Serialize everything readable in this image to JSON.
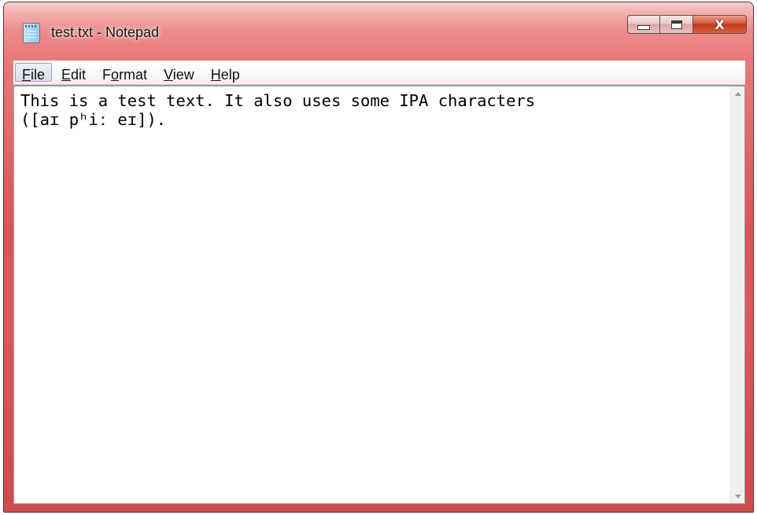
{
  "window": {
    "title": "test.txt - Notepad",
    "app_icon": "notepad-icon",
    "caption_buttons": {
      "minimize_icon": "minimize-icon",
      "maximize_icon": "maximize-icon",
      "close_glyph": "X"
    },
    "frame_color": "#d85555"
  },
  "menubar": {
    "items": [
      {
        "accel": "F",
        "rest": "ile"
      },
      {
        "accel": "E",
        "rest": "dit"
      },
      {
        "pre": "F",
        "accel": "o",
        "rest": "rmat"
      },
      {
        "accel": "V",
        "rest": "iew"
      },
      {
        "accel": "H",
        "rest": "elp"
      }
    ]
  },
  "editor": {
    "content": "This is a test text. It also uses some IPA characters\n([aɪ pʰiː eɪ]).",
    "scrollbar": {
      "up_icon": "scroll-up-arrow-icon",
      "down_icon": "scroll-down-arrow-icon"
    }
  }
}
